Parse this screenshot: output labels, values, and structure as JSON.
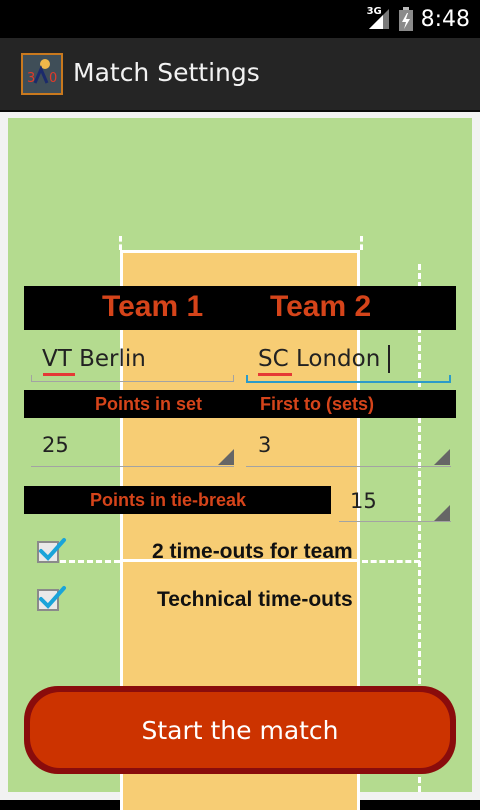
{
  "status_bar": {
    "network": "3G",
    "time": "8:48"
  },
  "action_bar": {
    "title": "Match Settings",
    "icon": "app-icon"
  },
  "teams": {
    "team1_header": "Team 1",
    "team2_header": "Team 2",
    "team1_name": "VT Berlin",
    "team2_name": "SC London"
  },
  "settings": {
    "points_in_set_label": "Points in set",
    "points_in_set_value": "25",
    "first_to_label": "First to (sets)",
    "first_to_value": "3",
    "tiebreak_label": "Points in tie-break",
    "tiebreak_value": "15"
  },
  "options": {
    "timeouts_label": "2 time-outs for team",
    "timeouts_checked": true,
    "technical_label": "Technical time-outs",
    "technical_checked": true
  },
  "actions": {
    "start_label": "Start the match"
  },
  "colors": {
    "accent": "#D5441A",
    "court_green": "#B4DB8F",
    "court_orange": "#F7CD74",
    "button_red": "#CC3300",
    "focus_blue": "#2B9BC9"
  }
}
